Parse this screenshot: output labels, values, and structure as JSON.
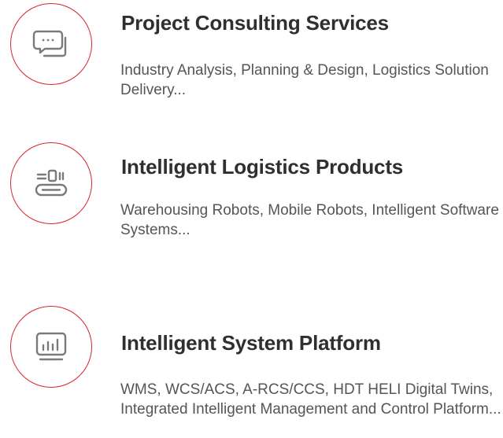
{
  "colors": {
    "accent": "#d9232d",
    "icon": "#7a7a7a",
    "title": "#2f2f2f",
    "text": "#555555"
  },
  "services": [
    {
      "icon": "chat-bubbles-icon",
      "title": "Project Consulting Services",
      "description": "Industry Analysis, Planning & Design, Logistics Solution Delivery..."
    },
    {
      "icon": "robot-conveyor-icon",
      "title": "Intelligent Logistics Products",
      "description": "Warehousing Robots, Mobile Robots, Intelligent Software Systems..."
    },
    {
      "icon": "monitor-chart-icon",
      "title": "Intelligent System Platform",
      "description": "WMS, WCS/ACS, A-RCS/CCS, HDT HELI Digital Twins, Integrated Intelligent Management and Control Platform..."
    }
  ]
}
